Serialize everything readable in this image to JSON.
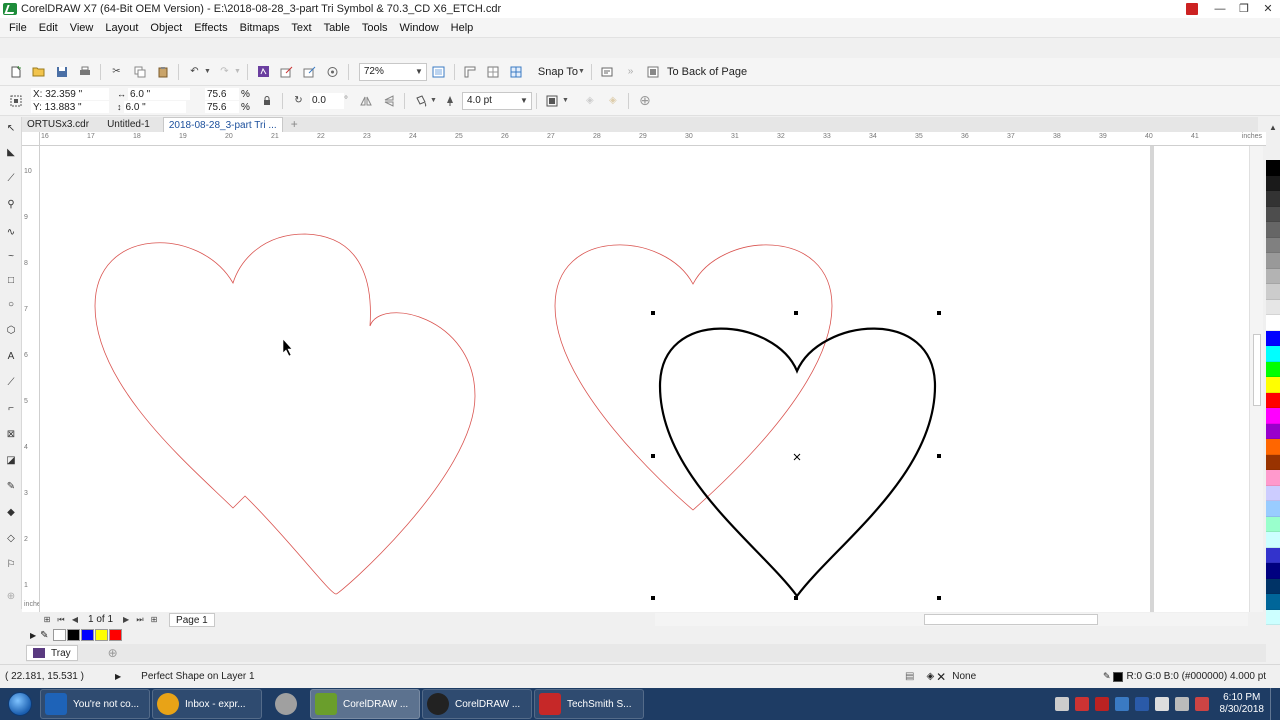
{
  "window": {
    "title": "CorelDRAW X7 (64-Bit OEM Version) - E:\\2018-08-28_3-part Tri Symbol & 70.3_CD X6_ETCH.cdr",
    "minimize": "—",
    "restore": "❐",
    "close": "✕"
  },
  "menu": [
    "File",
    "Edit",
    "View",
    "Layout",
    "Object",
    "Effects",
    "Bitmaps",
    "Text",
    "Table",
    "Tools",
    "Window",
    "Help"
  ],
  "std_toolbar": {
    "zoom": "72%",
    "snap_to": "Snap To",
    "to_back": "To Back of Page"
  },
  "prop_bar": {
    "x": "X: 32.359 \"",
    "y": "Y: 13.883 \"",
    "width": "6.0 \"",
    "height": "6.0 \"",
    "scale_w": "75.6",
    "scale_h": "75.6",
    "pct": "%",
    "rotation": "0.0",
    "degree": "°",
    "outline": "4.0 pt"
  },
  "doc_tabs": [
    "ORTUSx3.cdr",
    "Untitled-1",
    "2018-08-28_3-part Tri ..."
  ],
  "ruler": {
    "h_labels": [
      "16",
      "17",
      "18",
      "19",
      "20",
      "21",
      "22",
      "23",
      "24",
      "25",
      "26",
      "27",
      "28",
      "29",
      "30",
      "31",
      "32",
      "33",
      "34",
      "35",
      "36",
      "37",
      "38",
      "39",
      "40",
      "41"
    ],
    "h_unit": "inches",
    "v_labels": [
      "10",
      "9",
      "8",
      "7",
      "6",
      "5",
      "4",
      "3",
      "2",
      "1"
    ],
    "v_unit": "inches"
  },
  "page_nav": {
    "count": "1 of 1",
    "page_tab": "Page 1"
  },
  "tray": {
    "label": "Tray"
  },
  "status": {
    "coords": "( 22.181, 15.531 )",
    "shape_info": "Perfect Shape on Layer 1",
    "fill": "None",
    "outline": "R:0 G:0 B:0 (#000000)  4.000 pt"
  },
  "palette_colors": [
    "#000000",
    "#1a1a1a",
    "#333333",
    "#4d4d4d",
    "#666666",
    "#808080",
    "#999999",
    "#b3b3b3",
    "#cccccc",
    "#e6e6e6",
    "#ffffff",
    "#0000ff",
    "#00ffff",
    "#00ff00",
    "#ffff00",
    "#ff0000",
    "#ff00ff",
    "#9900cc",
    "#ff6600",
    "#993300",
    "#ff99cc",
    "#ccccff",
    "#99ccff",
    "#99ffcc",
    "#ccffff",
    "#3333cc",
    "#000080",
    "#003366",
    "#006699",
    "#ccffff"
  ],
  "doc_palette_colors": [
    "#000000",
    "#0000ff",
    "#ffff00",
    "#ff0000"
  ],
  "taskbar": {
    "buttons": [
      {
        "label": "You're not co...",
        "color": "#1e63b8"
      },
      {
        "label": "Inbox - expr...",
        "color": "#e8a317"
      },
      {
        "label": "",
        "color": "#a0a0a0"
      },
      {
        "label": "CorelDRAW ...",
        "color": "#6a9e2c"
      },
      {
        "label": "CorelDRAW ...",
        "color": "#222222"
      },
      {
        "label": "TechSmith S...",
        "color": "#c62828"
      }
    ],
    "time": "6:10 PM",
    "date": "8/30/2018"
  },
  "colors": {
    "accent": "#1b4f9c",
    "red_outline": "#d9534f",
    "selected_outline": "#000000",
    "taskbar": "#1e3c64"
  }
}
